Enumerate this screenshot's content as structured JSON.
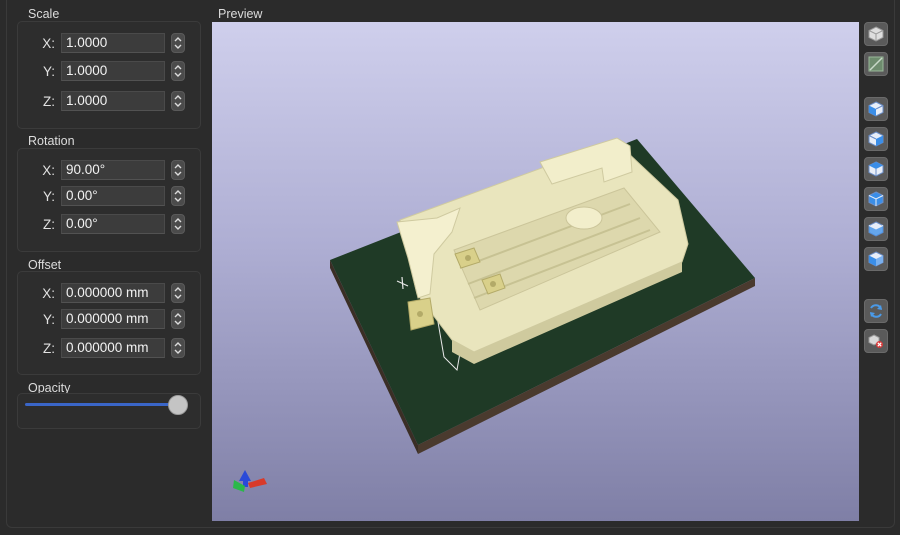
{
  "scale": {
    "title": "Scale",
    "rows": [
      {
        "axis": "X:",
        "value": "1.0000"
      },
      {
        "axis": "Y:",
        "value": "1.0000"
      },
      {
        "axis": "Z:",
        "value": "1.0000"
      }
    ]
  },
  "rotation": {
    "title": "Rotation",
    "rows": [
      {
        "axis": "X:",
        "value": "90.00°"
      },
      {
        "axis": "Y:",
        "value": "0.00°"
      },
      {
        "axis": "Z:",
        "value": "0.00°"
      }
    ]
  },
  "offset": {
    "title": "Offset",
    "rows": [
      {
        "axis": "X:",
        "value": "0.000000 mm"
      },
      {
        "axis": "Y:",
        "value": "0.000000 mm"
      },
      {
        "axis": "Z:",
        "value": "0.000000 mm"
      }
    ]
  },
  "opacity": {
    "title": "Opacity",
    "level": 1.0
  },
  "preview": {
    "title": "Preview"
  },
  "toolbar": {
    "icons": [
      "render-icon",
      "raytrace-icon",
      "view-iso-icon",
      "view-left-icon",
      "view-right-icon",
      "view-front-icon",
      "view-back-icon",
      "view-top-icon",
      "reload-icon",
      "reset-view-icon"
    ]
  },
  "colors": {
    "accent": "#3a66c8",
    "pcb": "#1f3a26",
    "model": "#f0ecc8"
  }
}
